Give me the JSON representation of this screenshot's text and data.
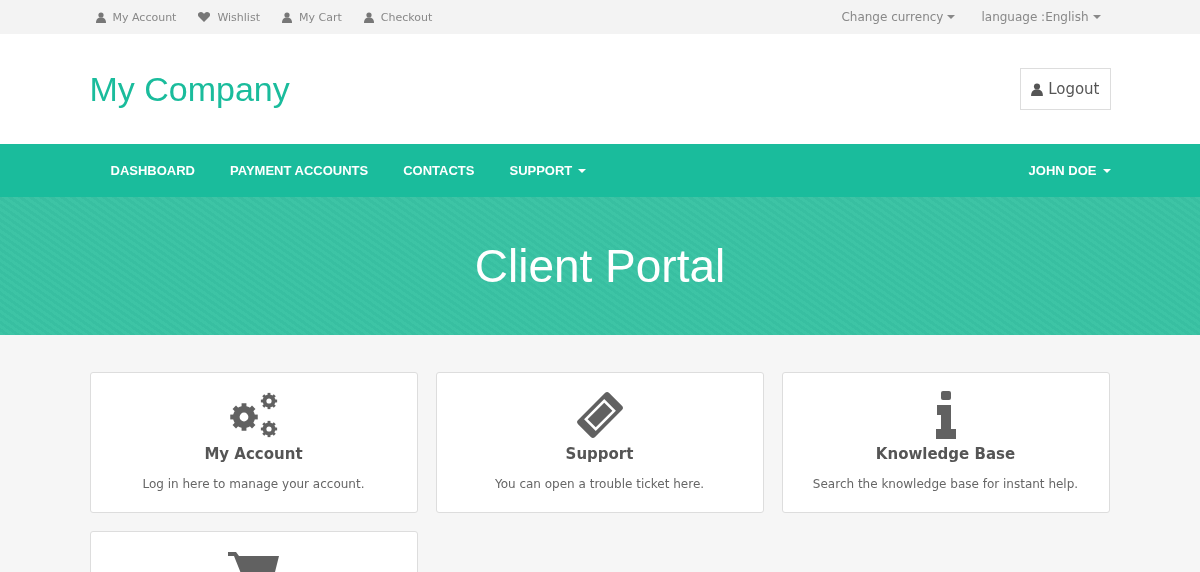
{
  "top_bar": {
    "links": [
      {
        "label": "My Account",
        "kind": "user"
      },
      {
        "label": "Wishlist",
        "kind": "heart"
      },
      {
        "label": "My Cart",
        "kind": "user"
      },
      {
        "label": "Checkout",
        "kind": "user"
      }
    ],
    "dropdowns": [
      "Change currency",
      "language :English"
    ]
  },
  "header": {
    "logo": "My Company",
    "logout_button": "Logout"
  },
  "nav": {
    "items": [
      {
        "label": "DASHBOARD",
        "dropdown": false
      },
      {
        "label": "PAYMENT ACCOUNTS",
        "dropdown": false
      },
      {
        "label": "CONTACTS",
        "dropdown": false
      },
      {
        "label": "SUPPORT",
        "dropdown": true
      }
    ],
    "user_menu": "JOHN DOE"
  },
  "banner": {
    "title": "Client Portal"
  },
  "cards": [
    {
      "kind": "gears",
      "title": "My Account",
      "description": "Log in here to manage your account."
    },
    {
      "kind": "ticket",
      "title": "Support",
      "description": "You can open a trouble ticket here."
    },
    {
      "kind": "info",
      "title": "Knowledge Base",
      "description": "Search the knowledge base for instant help."
    },
    {
      "kind": "cart"
    }
  ]
}
